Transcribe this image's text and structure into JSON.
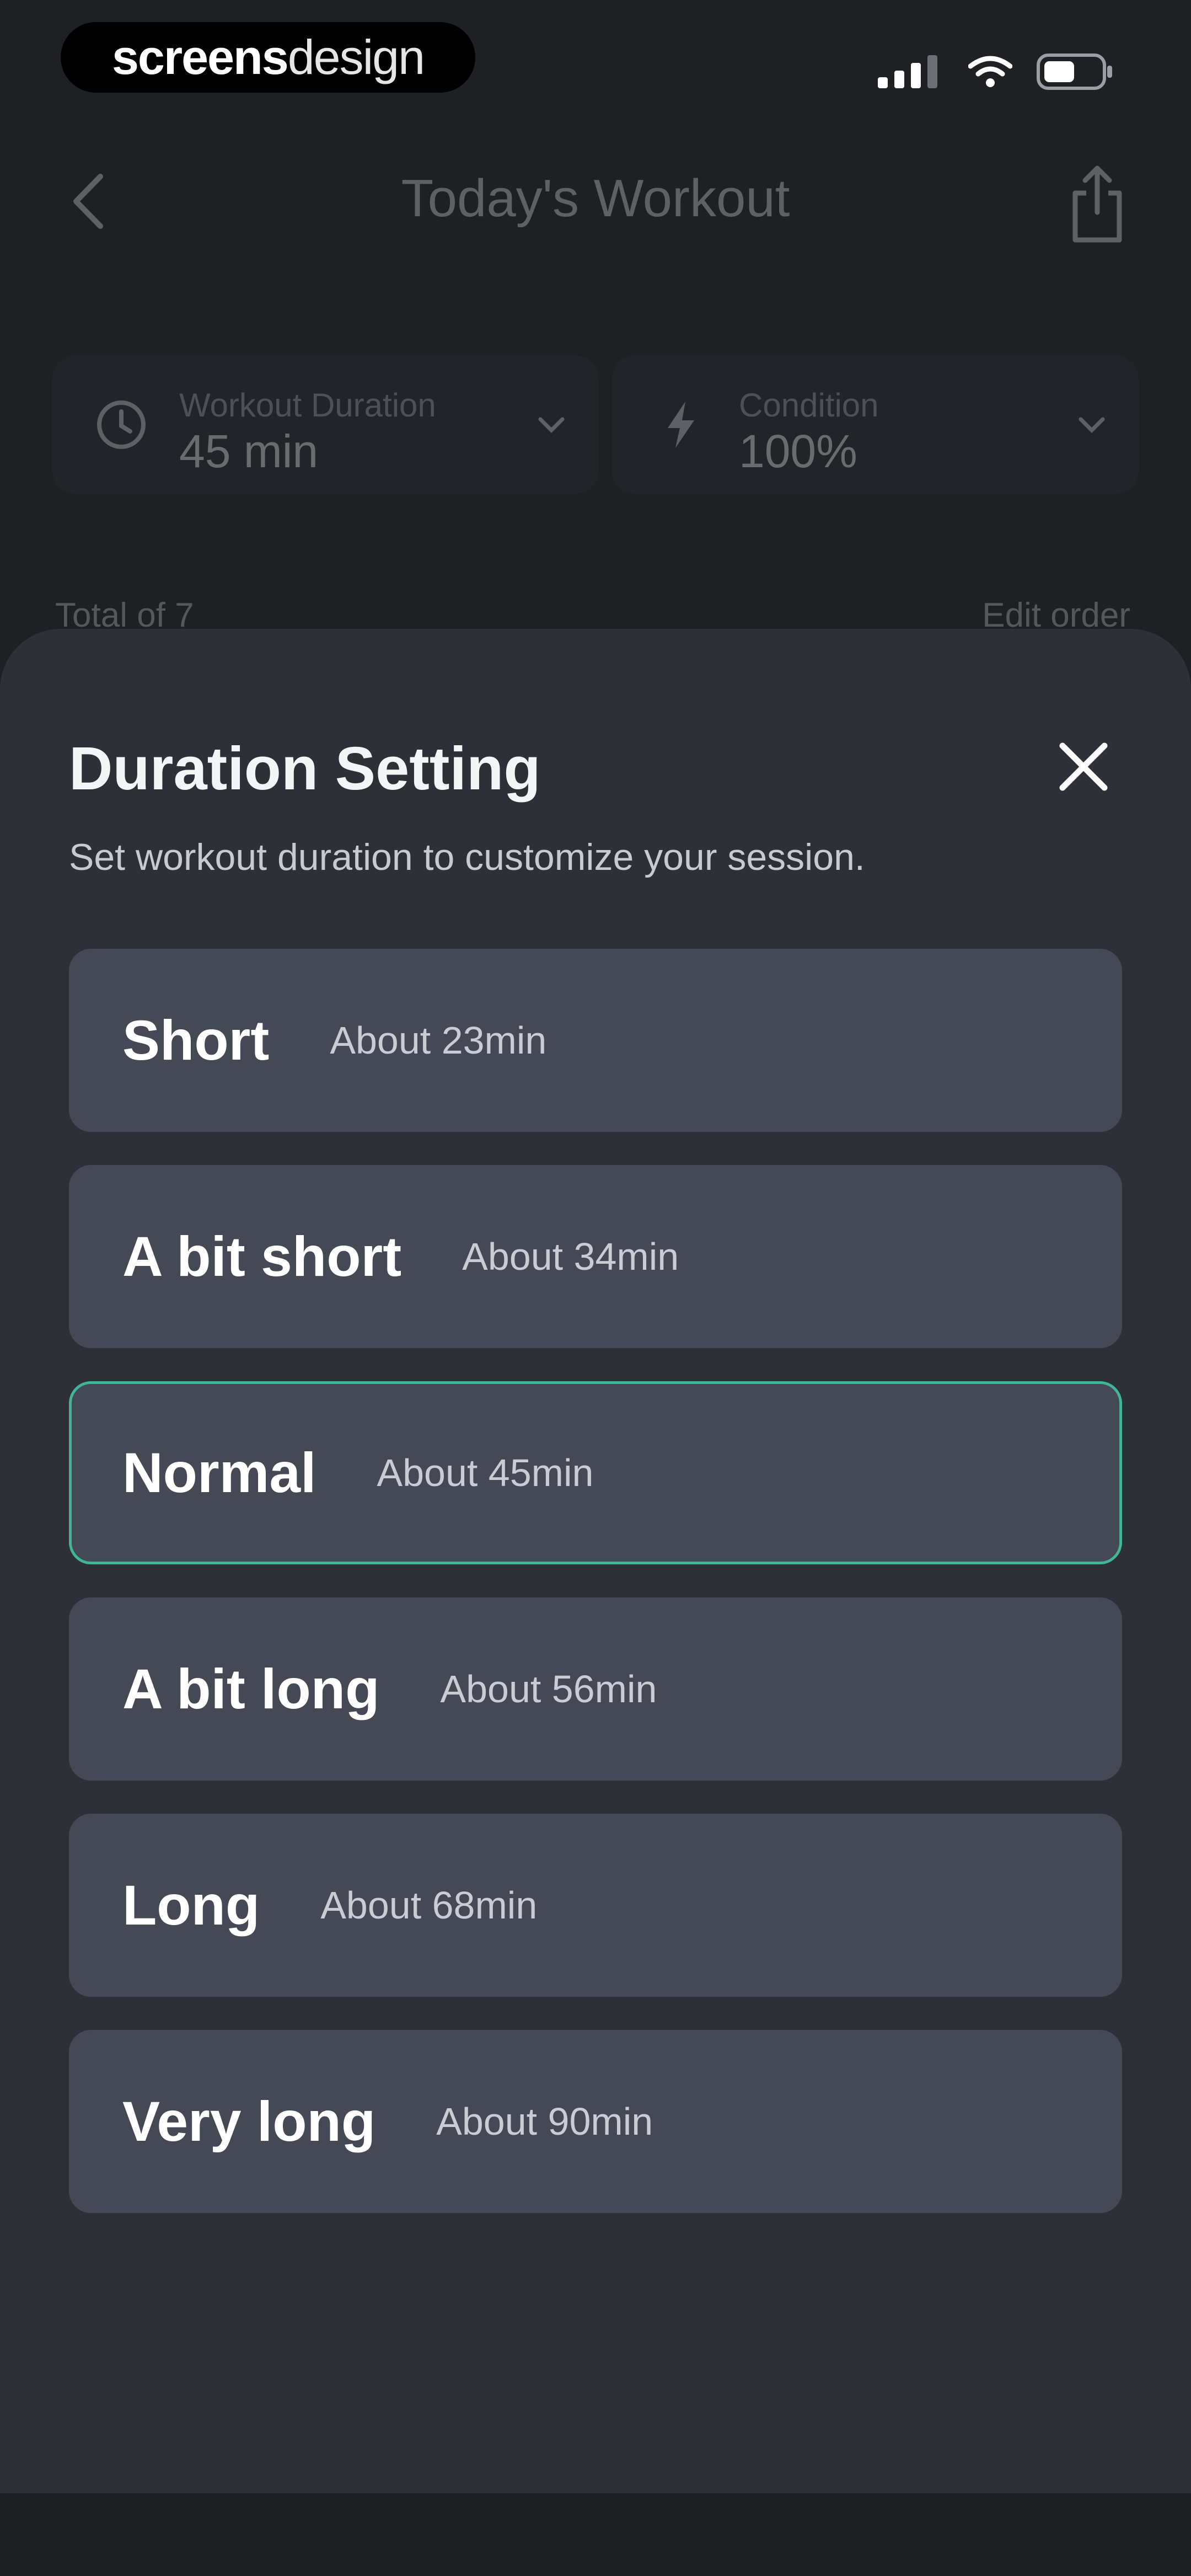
{
  "watermark": {
    "brand_bold": "screens",
    "brand_light": "design"
  },
  "status_bar": {
    "icons": [
      "signal-icon",
      "wifi-icon",
      "battery-icon"
    ]
  },
  "background": {
    "nav": {
      "title": "Today's Workout",
      "back_icon": "chevron-left-icon",
      "share_icon": "share-icon"
    },
    "cards": [
      {
        "label": "Workout Duration",
        "value": "45 min",
        "icon": "clock-icon"
      },
      {
        "label": "Condition",
        "value": "100%",
        "icon": "lightning-icon"
      }
    ],
    "total_label": "Total of 7",
    "edit_label": "Edit order"
  },
  "sheet": {
    "title": "Duration Setting",
    "subtitle": "Set workout duration to customize your session.",
    "close_icon": "close-icon",
    "options": [
      {
        "name": "Short",
        "time": "About 23min",
        "selected": false
      },
      {
        "name": "A bit short",
        "time": "About 34min",
        "selected": false
      },
      {
        "name": "Normal",
        "time": "About 45min",
        "selected": true
      },
      {
        "name": "A bit long",
        "time": "About 56min",
        "selected": false
      },
      {
        "name": "Long",
        "time": "About 68min",
        "selected": false
      },
      {
        "name": "Very long",
        "time": "About 90min",
        "selected": false
      }
    ]
  },
  "colors": {
    "background": "#1e2024",
    "sheet": "#2d3037",
    "option": "#454955",
    "selected_border": "#3fb797"
  }
}
